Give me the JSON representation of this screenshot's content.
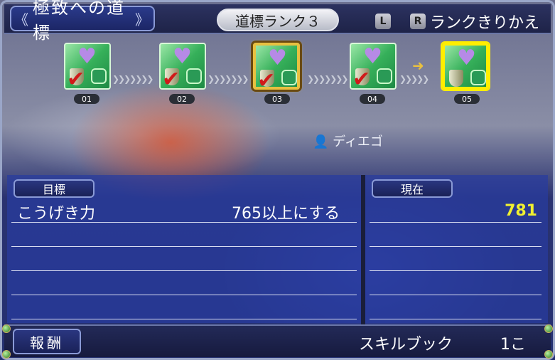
{
  "header": {
    "title": "極致への道標",
    "rank_label": "道標ランク３",
    "key_left": "L",
    "key_right": "R",
    "switch_label": "ランクきりかえ"
  },
  "milestones": [
    {
      "number": "01",
      "completed": true
    },
    {
      "number": "02",
      "completed": true
    },
    {
      "number": "03",
      "completed": true,
      "current_rank_marker": true
    },
    {
      "number": "04",
      "completed": true
    },
    {
      "number": "05",
      "completed": false,
      "selected": true
    }
  ],
  "scene": {
    "npc_name": "ディエゴ"
  },
  "objective": {
    "goal_tab": "目標",
    "current_tab": "現在",
    "stat_name": "こうげき力",
    "requirement": "765以上にする",
    "current_value": "781"
  },
  "reward": {
    "tab": "報酬",
    "item": "スキルブック",
    "quantity": "1こ"
  },
  "colors": {
    "check": "#d01a1a",
    "selection": "#ffee00",
    "current_value": "#f0f030"
  }
}
